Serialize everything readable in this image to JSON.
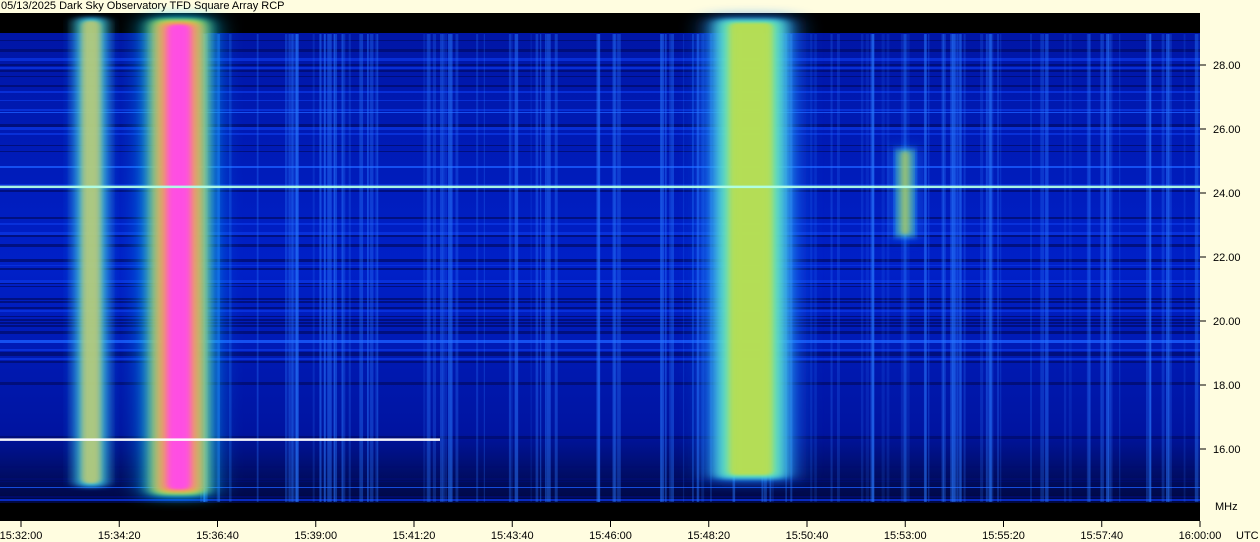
{
  "chart_data": {
    "type": "heatmap",
    "title": "05/13/2025 Dark Sky Observatory TFD Square Array RCP",
    "xlabel": "UTC",
    "ylabel": "MHz",
    "x_range": [
      "15:32:00",
      "16:00:00"
    ],
    "y_range_mhz": [
      14.5,
      29.5
    ],
    "x_ticks": [
      "15:32:00",
      "15:34:20",
      "15:36:40",
      "15:39:00",
      "15:41:20",
      "15:43:40",
      "15:46:00",
      "15:48:20",
      "15:50:40",
      "15:53:00",
      "15:55:20",
      "15:57:40",
      "16:00:00"
    ],
    "y_ticks": [
      "16.00",
      "18.00",
      "20.00",
      "22.00",
      "24.00",
      "26.00",
      "28.00"
    ],
    "colormap": [
      "#000000",
      "#0000a0",
      "#0040ff",
      "#00c0ff",
      "#80ff80",
      "#ffff00",
      "#ff8000",
      "#ff00ff",
      "#ffffff"
    ],
    "bursts": [
      {
        "start": "15:33:20",
        "end": "15:34:00",
        "f_low": 14.8,
        "f_high": 29.5,
        "intensity": "high"
      },
      {
        "start": "15:35:00",
        "end": "15:36:30",
        "f_low": 14.5,
        "f_high": 29.5,
        "intensity": "very high"
      },
      {
        "start": "15:48:20",
        "end": "15:50:20",
        "f_low": 15.0,
        "f_high": 29.5,
        "intensity": "medium"
      },
      {
        "start": "15:52:50",
        "end": "15:53:10",
        "f_low": 22.5,
        "f_high": 25.5,
        "intensity": "medium"
      }
    ],
    "constant_lines_mhz": [
      24.2,
      16.3
    ],
    "grid": false,
    "legend": "none"
  }
}
